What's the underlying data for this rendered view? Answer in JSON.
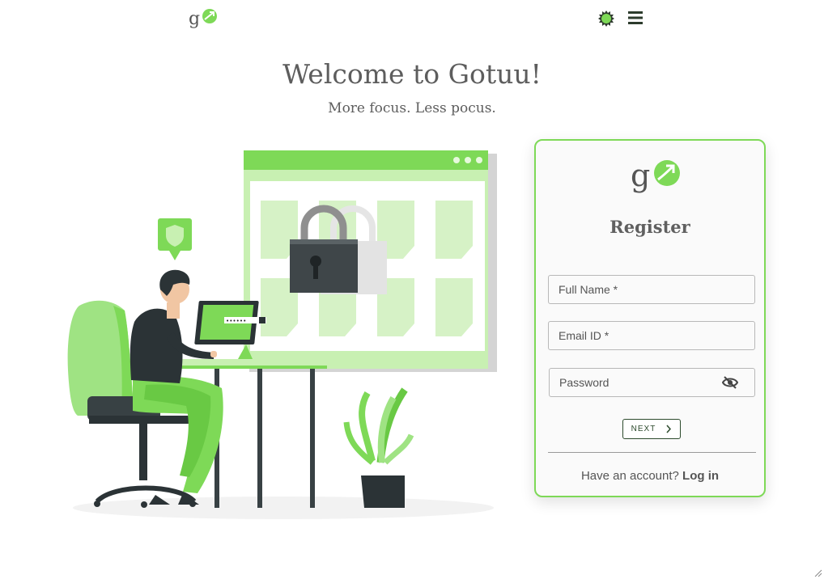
{
  "header": {
    "logo_icon": "gotuu-logo-icon",
    "settings_icon": "settings-badge-icon",
    "menu_icon": "hamburger-menu-icon"
  },
  "hero": {
    "title": "Welcome to Gotuu!",
    "subtitle": "More focus. Less pocus."
  },
  "illustration": {
    "name": "person-at-desk-security-illustration",
    "laptop_text": "••••••"
  },
  "register": {
    "title": "Register",
    "full_name_placeholder": "Full Name *",
    "email_placeholder": "Email ID *",
    "password_placeholder": "Password",
    "password_toggle_icon": "eye-off-icon",
    "next_label": "NEXT",
    "next_icon": "chevron-right-icon",
    "have_account_text": "Have an account?",
    "login_label": "Log in"
  },
  "colors": {
    "brand_green": "#7ed957",
    "text_gray": "#5d5d5d",
    "dark": "#2c3b2c"
  }
}
